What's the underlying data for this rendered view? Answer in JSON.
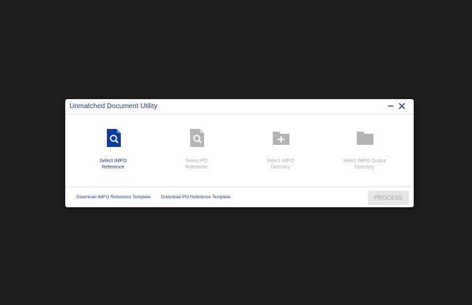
{
  "dialog": {
    "title": "Unmatched Document Utility",
    "minimize_icon": "minimize-icon",
    "close_icon": "close-icon"
  },
  "tiles": [
    {
      "label": "Select IMPO\nReference",
      "icon": "file-search-icon",
      "state": "active"
    },
    {
      "label": "Select PO\nReference",
      "icon": "file-search-icon",
      "state": "disabled"
    },
    {
      "label": "Select IMPO\nDirectory",
      "icon": "folder-plus-icon",
      "state": "disabled"
    },
    {
      "label": "Select IMPO Output\nDirectory",
      "icon": "folder-icon",
      "state": "disabled"
    }
  ],
  "footer": {
    "link_impo_template": "Download IMPO Reference Template",
    "link_po_template": "Download PO Reference Template",
    "process_label": "PROCESS"
  },
  "colors": {
    "accent": "#1f3a8a",
    "active_icon": "#0d3b9e",
    "disabled": "#a9a9a9",
    "background": "#1f1f1f"
  }
}
